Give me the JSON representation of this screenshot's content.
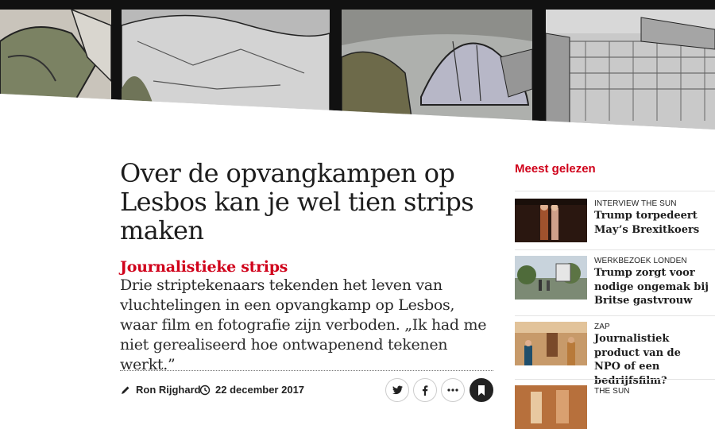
{
  "article": {
    "headline": "Over de opvangkampen op Lesbos kan je wel tien strips maken",
    "kicker": "Journalistieke strips",
    "intro": "Drie striptekenaars tekenden het leven van vluchtelingen in een opvangkamp op Lesbos, waar film en fotografie zijn verboden. „Ik had me niet gerealiseerd hoe ontwapenend tekenen werkt.”",
    "author": "Ron Rijghard",
    "date": "22 december 2017"
  },
  "icons": {
    "author": "pencil-icon",
    "date": "clock-icon",
    "share_twitter": "twitter-icon",
    "share_facebook": "facebook-icon",
    "more": "more-icon",
    "bookmark": "bookmark-icon"
  },
  "sidebar": {
    "title": "Meest gelezen",
    "items": [
      {
        "label": "Interview The Sun",
        "title": "Trump torpedeert May’s Brexitkoers"
      },
      {
        "label": "Werkbezoek Londen",
        "title": "Trump zorgt voor nodige ongemak bij Britse gastvrouw"
      },
      {
        "label": "ZAP",
        "title": "Journalistiek product van de NPO of een bedrijfsfilm?"
      },
      {
        "label": "The Sun",
        "title": ""
      }
    ]
  },
  "colors": {
    "accent": "#d0021b",
    "text": "#1d1d1d"
  }
}
